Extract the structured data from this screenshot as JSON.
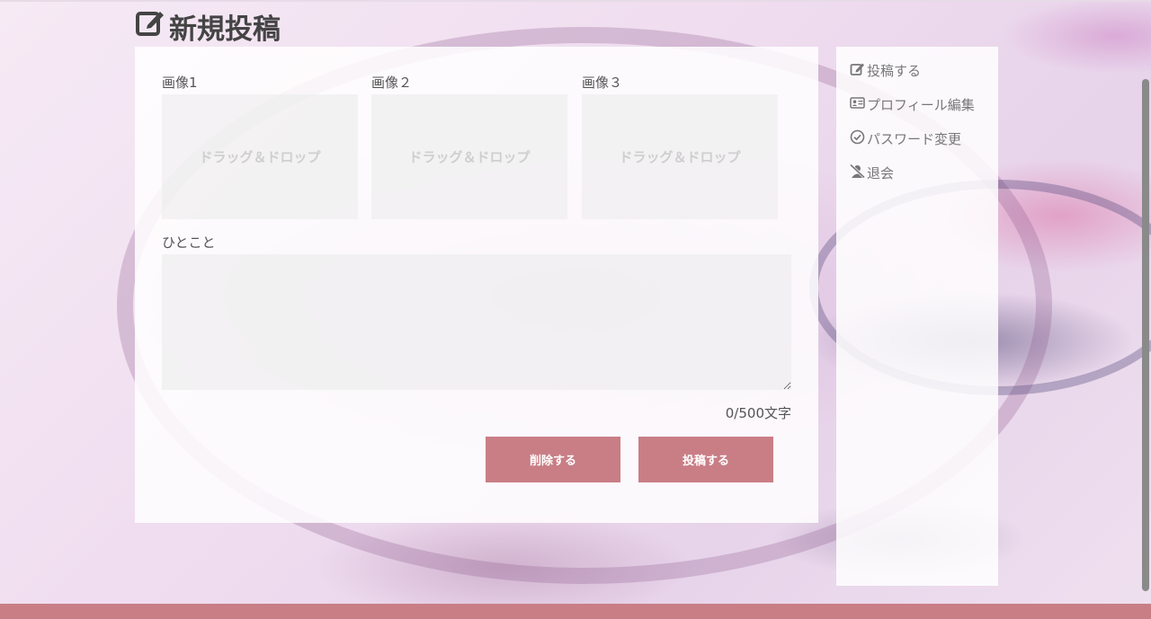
{
  "page": {
    "title": "新規投稿",
    "title_icon": "edit-icon"
  },
  "form": {
    "images": [
      {
        "label": "画像1",
        "dropzone_text": "ドラッグ＆ドロップ"
      },
      {
        "label": "画像２",
        "dropzone_text": "ドラッグ＆ドロップ"
      },
      {
        "label": "画像３",
        "dropzone_text": "ドラッグ＆ドロップ"
      }
    ],
    "comment_label": "ひとこと",
    "comment_value": "",
    "char_counter": "0/500文字",
    "delete_button": "削除する",
    "submit_button": "投稿する"
  },
  "sidebar": {
    "items": [
      {
        "label": "投稿する",
        "icon": "edit-icon"
      },
      {
        "label": "プロフィール編集",
        "icon": "id-card-icon"
      },
      {
        "label": "パスワード変更",
        "icon": "check-circle-icon"
      },
      {
        "label": "退会",
        "icon": "user-slash-icon"
      }
    ]
  },
  "colors": {
    "accent": "#c97e86",
    "panel": "#ffffff",
    "text": "#555555"
  }
}
